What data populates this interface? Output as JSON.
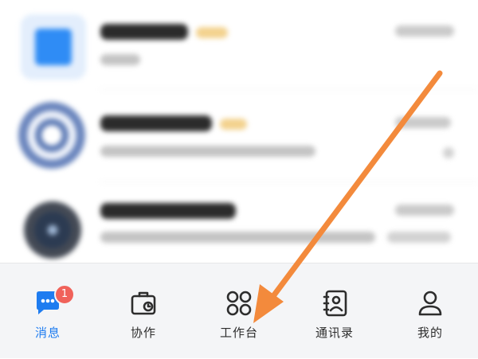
{
  "tabbar": {
    "items": [
      {
        "label": "消息",
        "icon": "chat-bubble-icon",
        "active": true,
        "badge": "1"
      },
      {
        "label": "协作",
        "icon": "briefcase-icon",
        "active": false
      },
      {
        "label": "工作台",
        "icon": "grid-icon",
        "active": false
      },
      {
        "label": "通讯录",
        "icon": "contacts-book-icon",
        "active": false
      },
      {
        "label": "我的",
        "icon": "person-icon",
        "active": false
      }
    ]
  },
  "colors": {
    "accent": "#1e7cf0",
    "badge": "#f0625a",
    "arrow": "#f38a3c"
  }
}
